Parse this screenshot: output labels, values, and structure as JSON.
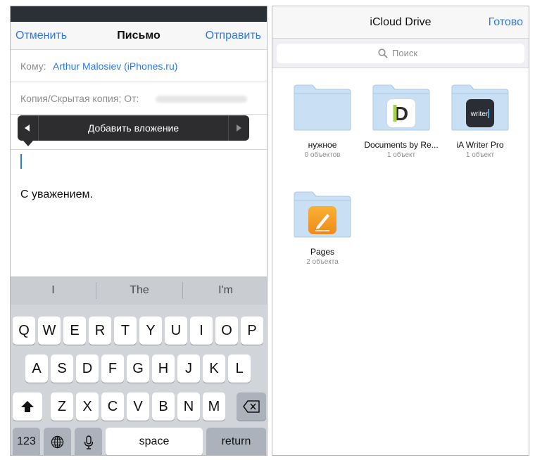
{
  "mail": {
    "cancel_label": "Отменить",
    "title": "Письмо",
    "send_label": "Отправить",
    "to_label": "Кому:",
    "to_value": "Arthur Malosiev (iPhones.ru)",
    "cc_label": "Копия/Скрытая копия; От:",
    "menu_label": "Добавить вложение",
    "signature": "С уважением."
  },
  "keyboard": {
    "suggestions": [
      "I",
      "The",
      "I'm"
    ],
    "row1": [
      "Q",
      "W",
      "E",
      "R",
      "T",
      "Y",
      "U",
      "I",
      "O",
      "P"
    ],
    "row2": [
      "A",
      "S",
      "D",
      "F",
      "G",
      "H",
      "J",
      "K",
      "L"
    ],
    "row3": [
      "Z",
      "X",
      "C",
      "V",
      "B",
      "N",
      "M"
    ],
    "numbers_label": "123",
    "space_label": "space",
    "return_label": "return",
    "icons": {
      "shift": "shift-arrow-icon",
      "delete": "backspace-icon",
      "globe": "globe-icon",
      "mic": "microphone-icon"
    }
  },
  "drive": {
    "title": "iCloud Drive",
    "done_label": "Готово",
    "search_placeholder": "Поиск",
    "folders": [
      {
        "name": "нужное",
        "count": "0 объектов",
        "badge": ""
      },
      {
        "name": "Documents by Re...",
        "count": "1 объект",
        "badge": "documents-app-icon"
      },
      {
        "name": "iA Writer Pro",
        "count": "1 объект",
        "badge": "ia-writer-app-icon"
      },
      {
        "name": "Pages",
        "count": "2 объекта",
        "badge": "pages-app-icon"
      }
    ],
    "badge_text": {
      "documents": "D",
      "writer": "writer"
    }
  },
  "colors": {
    "accent": "#2f7ae5",
    "folder": "#c9e0f4",
    "folder_edge": "#a9c9e6"
  }
}
